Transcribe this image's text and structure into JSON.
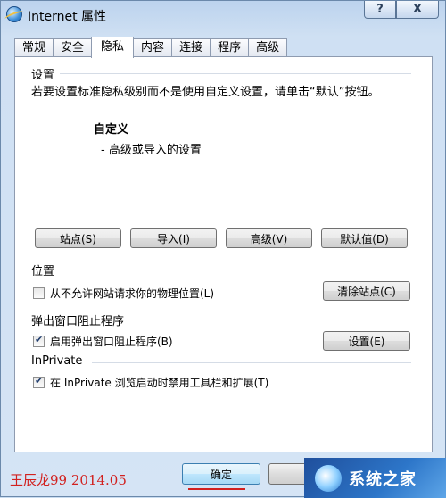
{
  "window": {
    "title": "Internet 属性",
    "help_label": "?",
    "close_label": "X"
  },
  "tabs": [
    {
      "label": "常规"
    },
    {
      "label": "安全"
    },
    {
      "label": "隐私",
      "active": true
    },
    {
      "label": "内容"
    },
    {
      "label": "连接"
    },
    {
      "label": "程序"
    },
    {
      "label": "高级"
    }
  ],
  "settings": {
    "group_label": "设置",
    "description": "若要设置标准隐私级别而不是使用自定义设置，请单击“默认”按钮。",
    "level_title": "自定义",
    "level_desc": "- 高级或导入的设置",
    "buttons": {
      "sites": "站点(S)",
      "import": "导入(I)",
      "advanced": "高级(V)",
      "default": "默认值(D)"
    }
  },
  "location": {
    "group_label": "位置",
    "checkbox_label": "从不允许网站请求你的物理位置(L)",
    "checked": false,
    "clear_button": "清除站点(C)"
  },
  "popup": {
    "group_label": "弹出窗口阻止程序",
    "checkbox_label": "启用弹出窗口阻止程序(B)",
    "checked": true,
    "settings_button": "设置(E)"
  },
  "inprivate": {
    "group_label": "InPrivate",
    "checkbox_label": "在 InPrivate 浏览启动时禁用工具栏和扩展(T)",
    "checked": true
  },
  "footer": {
    "watermark": "王辰龙99 2014.05",
    "ok_label": "确定",
    "brand_text": "系统之家"
  }
}
